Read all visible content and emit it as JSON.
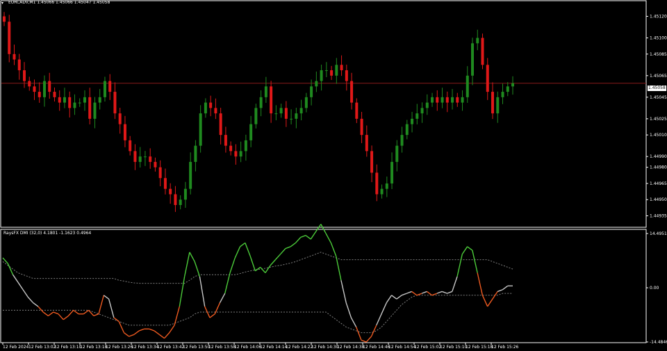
{
  "header": {
    "arrow_glyph": "▾",
    "title": "EURCADv,M1  1.45066 1.45066 1.45047 1.45058"
  },
  "subwindow": {
    "title": "RaysFX DMI (32,0)  4.1801 -1.1623 0.4964"
  },
  "price_scale": [
    "1.45120",
    "1.45100",
    "1.45085",
    "1.45065",
    "1.45045",
    "1.45025",
    "1.45010",
    "1.44990",
    "1.44980",
    "1.44965",
    "1.44950",
    "1.44935"
  ],
  "current_price_tag": "1.45058",
  "indicator_scale": [
    "14.4951",
    "0.00",
    "-14.4846"
  ],
  "time_labels": [
    "12 Feb 2024",
    "12 Feb 13:02",
    "12 Feb 13:10",
    "12 Feb 13:18",
    "12 Feb 13:26",
    "12 Feb 13:34",
    "12 Feb 13:42",
    "12 Feb 13:50",
    "12 Feb 13:58",
    "12 Feb 14:06",
    "12 Feb 14:14",
    "12 Feb 14:22",
    "12 Feb 14:30",
    "12 Feb 14:38",
    "12 Feb 14:46",
    "12 Feb 14:54",
    "12 Feb 15:02",
    "12 Feb 15:10",
    "12 Feb 15:18",
    "12 Feb 15:26"
  ],
  "colors": {
    "background": "#000000",
    "bull": "#1f8a1f",
    "bear": "#e01818",
    "price_line": "#8b1a1a",
    "axis": "#ffffff",
    "osc_neutral": "#c8c8c8",
    "osc_up": "#4ccc3a",
    "osc_down": "#ee5a20",
    "dotted": "#808080"
  },
  "chart_data": [
    {
      "type": "candlestick",
      "title": "EURCADv,M1",
      "x_unit": "minute index from 12 Feb 2024 12:55",
      "ylim": [
        1.44925,
        1.4513
      ],
      "current_price": 1.45058,
      "close": [
        1.45115,
        1.45085,
        1.4508,
        1.4507,
        1.4506,
        1.45055,
        1.4505,
        1.45045,
        1.4506,
        1.4505,
        1.45045,
        1.4504,
        1.45045,
        1.45035,
        1.4504,
        1.4504,
        1.45045,
        1.45025,
        1.4504,
        1.45045,
        1.4506,
        1.4505,
        1.4503,
        1.4502,
        1.45005,
        1.44995,
        1.44985,
        1.4499,
        1.4499,
        1.44985,
        1.4498,
        1.4497,
        1.4496,
        1.44955,
        1.44945,
        1.4495,
        1.4496,
        1.44985,
        1.45,
        1.4503,
        1.4504,
        1.45035,
        1.4503,
        1.4501,
        1.45,
        1.44995,
        1.4499,
        1.44995,
        1.45005,
        1.4502,
        1.45035,
        1.45045,
        1.45055,
        1.4503,
        1.4503,
        1.45035,
        1.45025,
        1.45025,
        1.4503,
        1.45035,
        1.45045,
        1.45055,
        1.4506,
        1.4507,
        1.4507,
        1.45065,
        1.45075,
        1.4507,
        1.4506,
        1.4504,
        1.45025,
        1.4501,
        1.44995,
        1.44975,
        1.44955,
        1.4496,
        1.44965,
        1.44985,
        1.45,
        1.4501,
        1.4502,
        1.45025,
        1.4503,
        1.45035,
        1.4504,
        1.45045,
        1.4504,
        1.45045,
        1.4504,
        1.45045,
        1.4504,
        1.45045,
        1.45065,
        1.45095,
        1.451,
        1.45075,
        1.4505,
        1.4503,
        1.45045,
        1.4505,
        1.45055,
        1.45058
      ]
    },
    {
      "type": "line",
      "title": "RaysFX DMI (32,0)",
      "ylim": [
        -14.4846,
        14.4951
      ],
      "values": [
        8.0,
        6.5,
        3.5,
        1.5,
        -0.5,
        -2.5,
        -4.0,
        -5.0,
        -6.5,
        -7.5,
        -6.5,
        -7.0,
        -8.5,
        -7.5,
        -6.0,
        -7.0,
        -7.0,
        -6.0,
        -7.5,
        -7.0,
        -2.0,
        -3.0,
        -8.0,
        -9.0,
        -12.0,
        -13.0,
        -12.5,
        -11.5,
        -11.0,
        -11.0,
        -11.5,
        -12.5,
        -13.5,
        -12.0,
        -10.0,
        -5.0,
        3.0,
        9.5,
        7.0,
        3.0,
        -5.0,
        -8.0,
        -7.0,
        -4.0,
        -1.5,
        4.0,
        8.0,
        11.0,
        12.0,
        8.5,
        4.5,
        5.5,
        4.0,
        6.0,
        7.5,
        9.0,
        10.5,
        11.0,
        12.0,
        13.5,
        14.0,
        13.0,
        15.0,
        17.0,
        14.5,
        12.0,
        8.5,
        2.0,
        -4.0,
        -8.0,
        -10.5,
        -14.0,
        -14.5,
        -13.0,
        -10.0,
        -7.0,
        -4.0,
        -2.0,
        -3.0,
        -2.0,
        -1.5,
        -1.0,
        -2.0,
        -1.5,
        -1.0,
        -2.0,
        -1.5,
        -1.0,
        -1.5,
        -1.0,
        3.0,
        9.0,
        11.0,
        10.0,
        4.0,
        -2.0,
        -5.0,
        -3.0,
        -1.0,
        -0.5,
        0.5,
        0.5
      ],
      "upper_band": [
        7.0,
        6.0,
        5.0,
        4.0,
        3.5,
        3.0,
        2.5,
        2.5,
        2.5,
        2.5,
        2.5,
        2.5,
        2.5,
        2.5,
        2.5,
        2.5,
        2.5,
        2.5,
        2.5,
        2.5,
        2.5,
        2.5,
        2.5,
        2.0,
        1.8,
        1.5,
        1.3,
        1.2,
        1.2,
        1.2,
        1.2,
        1.2,
        1.2,
        1.2,
        1.2,
        1.2,
        1.2,
        2.0,
        3.0,
        3.5,
        3.5,
        3.5,
        3.5,
        3.5,
        3.5,
        3.5,
        3.5,
        3.8,
        4.2,
        4.5,
        4.8,
        5.0,
        5.2,
        5.5,
        5.8,
        6.0,
        6.3,
        6.6,
        7.0,
        7.5,
        8.0,
        8.5,
        9.0,
        9.5,
        9.0,
        8.5,
        8.0,
        7.5,
        7.5,
        7.5,
        7.5,
        7.5,
        7.5,
        7.5,
        7.5,
        7.5,
        7.5,
        7.5,
        7.5,
        7.5,
        7.5,
        7.5,
        7.5,
        7.5,
        7.5,
        7.5,
        7.5,
        7.5,
        7.5,
        7.5,
        7.5,
        7.5,
        7.5,
        7.5,
        7.5,
        7.5,
        7.5,
        7.0,
        6.5,
        6.0,
        5.5,
        5.0
      ],
      "lower_band": [
        -6.0,
        -6.0,
        -6.0,
        -6.0,
        -6.0,
        -6.0,
        -6.0,
        -6.0,
        -6.0,
        -6.0,
        -6.0,
        -6.0,
        -6.0,
        -6.0,
        -6.0,
        -6.0,
        -6.0,
        -6.0,
        -6.5,
        -7.0,
        -7.5,
        -8.0,
        -8.5,
        -9.0,
        -9.5,
        -10.0,
        -10.0,
        -10.0,
        -10.0,
        -10.0,
        -10.0,
        -10.0,
        -10.0,
        -10.0,
        -9.5,
        -9.0,
        -8.5,
        -8.0,
        -7.0,
        -6.5,
        -6.5,
        -6.5,
        -6.5,
        -6.5,
        -6.5,
        -6.5,
        -6.5,
        -6.5,
        -6.5,
        -6.5,
        -6.5,
        -6.5,
        -6.5,
        -6.5,
        -6.5,
        -6.5,
        -6.5,
        -6.5,
        -6.5,
        -6.5,
        -6.5,
        -6.5,
        -6.5,
        -6.5,
        -6.5,
        -7.5,
        -8.5,
        -9.5,
        -10.5,
        -11.0,
        -11.5,
        -12.0,
        -12.0,
        -12.0,
        -11.5,
        -10.5,
        -9.0,
        -7.5,
        -6.0,
        -4.5,
        -3.5,
        -2.5,
        -2.0,
        -2.0,
        -2.0,
        -2.0,
        -2.0,
        -2.0,
        -2.0,
        -2.0,
        -2.0,
        -2.0,
        -2.0,
        -2.0,
        -2.0,
        -2.0,
        -2.0,
        -2.0,
        -2.0,
        -1.5,
        -1.5,
        -1.5
      ]
    }
  ]
}
